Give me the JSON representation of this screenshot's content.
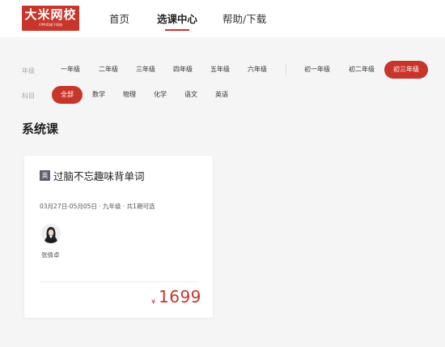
{
  "header": {
    "logo_title": "大米网校",
    "logo_subtitle": "VIPKID旗下网校",
    "nav": [
      "首页",
      "选课中心",
      "帮助/下载"
    ]
  },
  "filters": {
    "grade_label": "年级",
    "grades": [
      "一年级",
      "二年级",
      "三年级",
      "四年级",
      "五年级",
      "六年级",
      "初一年级",
      "初二年级",
      "初三年级"
    ],
    "selected_grade": "初三年级",
    "subject_label": "科目",
    "subjects": [
      "全部",
      "数学",
      "物理",
      "化学",
      "语文",
      "英语"
    ],
    "selected_subject": "全部"
  },
  "section_title": "系统课",
  "course": {
    "subject_badge": "英",
    "title": "过脑不忘趣味背单词",
    "meta": "03月27日-05月05日 · 九年级 · 共1期可选",
    "teacher": "张倩卓",
    "price_symbol": "¥",
    "price": "1699"
  },
  "colors": {
    "accent": "#c8352b",
    "badge": "#5b5e72",
    "page_bg": "#f5f5f5"
  }
}
